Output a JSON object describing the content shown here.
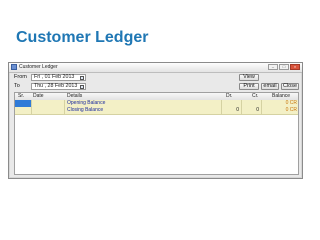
{
  "slide": {
    "title": "Customer Ledger"
  },
  "window": {
    "title": "Customer Ledger",
    "controls": {
      "minimize": "–",
      "maximize": "□",
      "close": "×"
    }
  },
  "filters": {
    "from_label": "From",
    "from_value": "Fri , 01 Feb 2013",
    "to_label": "To",
    "to_value": "Thu , 28 Feb 2013"
  },
  "buttons": {
    "view": "View",
    "print": "Print",
    "email": "email",
    "close": "Close"
  },
  "grid": {
    "columns": [
      "Sr.",
      "Date",
      "Details",
      "Dr.",
      "Cr.",
      "Balance"
    ],
    "rows": [
      {
        "details": "Opening Balance",
        "dr": "",
        "cr": "",
        "balance": "0 CR"
      },
      {
        "details": "Closing Balance",
        "dr": "0",
        "cr": "0",
        "balance": "0 CR"
      }
    ]
  },
  "colors": {
    "title": "#1f77b4",
    "row_bg": "#f3f0c6",
    "selected": "#2f7bd8"
  },
  "icons": {
    "app": "app-window-icon",
    "calendar": "calendar-icon"
  }
}
